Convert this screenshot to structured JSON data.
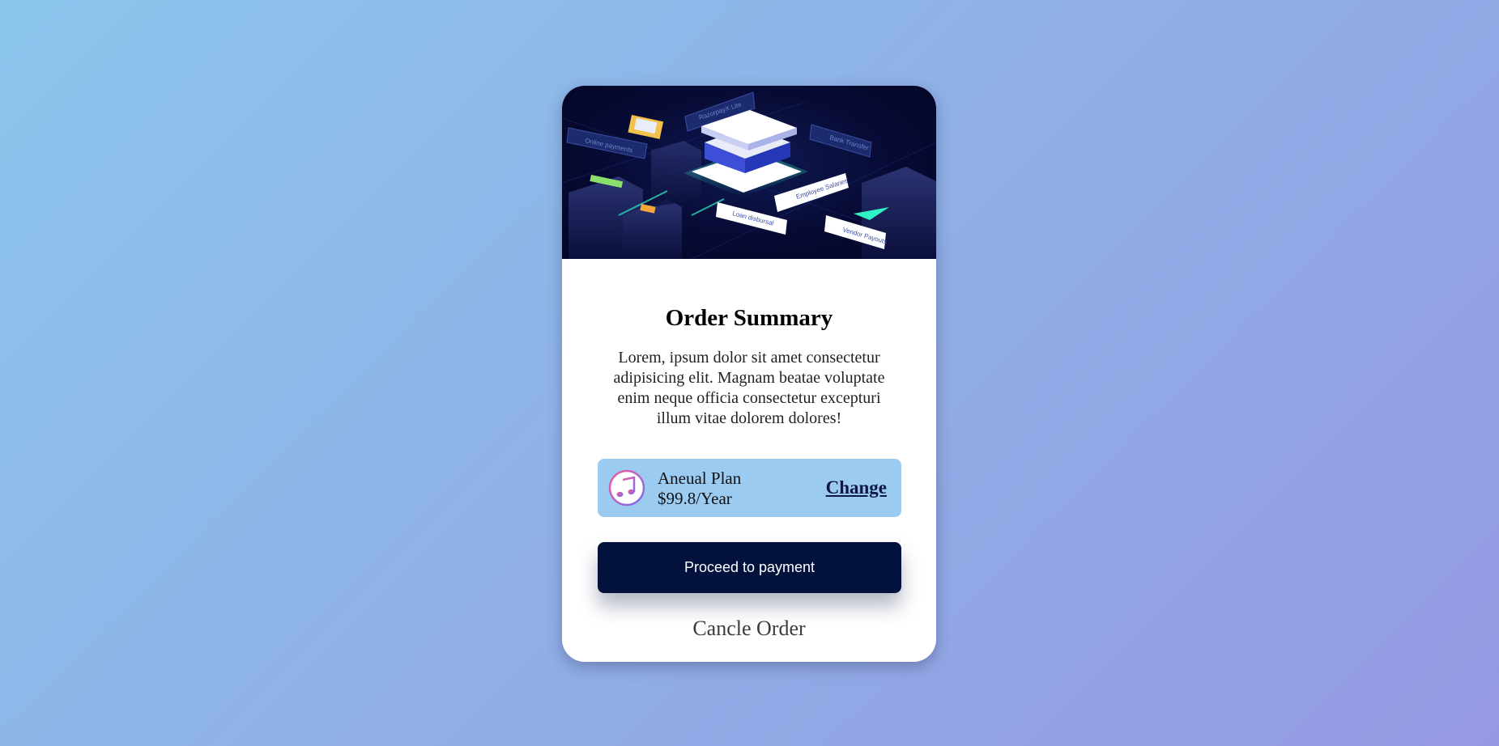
{
  "card": {
    "title": "Order Summary",
    "description": "Lorem, ipsum dolor sit amet consectetur adipisicing elit. Magnam beatae voluptate enim neque officia consectetur excepturi illum vitae dolorem dolores!",
    "hero_image": "isometric-payments-illustration",
    "hero_labels": [
      "Online payments",
      "Bank Transfer",
      "Employee Salaries",
      "Loan disbursal",
      "Vendor Payouts",
      "RazorpayX Lite"
    ]
  },
  "plan": {
    "icon": "music-note-icon",
    "name": "Aneual Plan",
    "price": "$99.8/Year",
    "change_label": "Change"
  },
  "actions": {
    "proceed_label": "Proceed to payment",
    "cancel_label": "Cancle Order"
  },
  "colors": {
    "background_start": "#8bc6ec",
    "background_end": "#9599e2",
    "plan_bg": "#9ccbf1",
    "button_bg": "#02123d"
  }
}
